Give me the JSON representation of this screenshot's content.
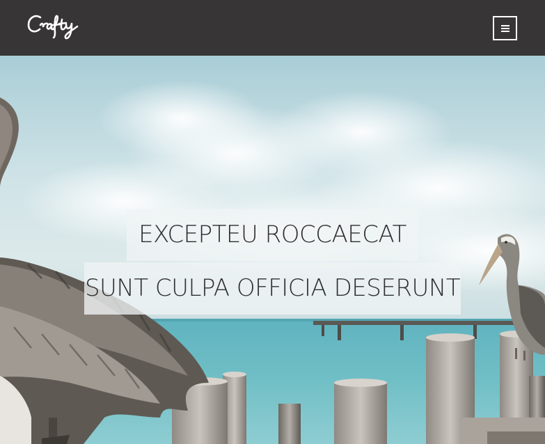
{
  "header": {
    "logo_text": "Crafty",
    "menu_icon": "hamburger-menu-icon",
    "background_color": "#373536"
  },
  "hero": {
    "headline_line_1": "EXCEPTEU ROCCAECAT",
    "headline_line_2": "SUNT CULPA OFFICIA DESERUNT",
    "scene": "pelicans-on-wooden-pier-posts-by-the-sea"
  }
}
